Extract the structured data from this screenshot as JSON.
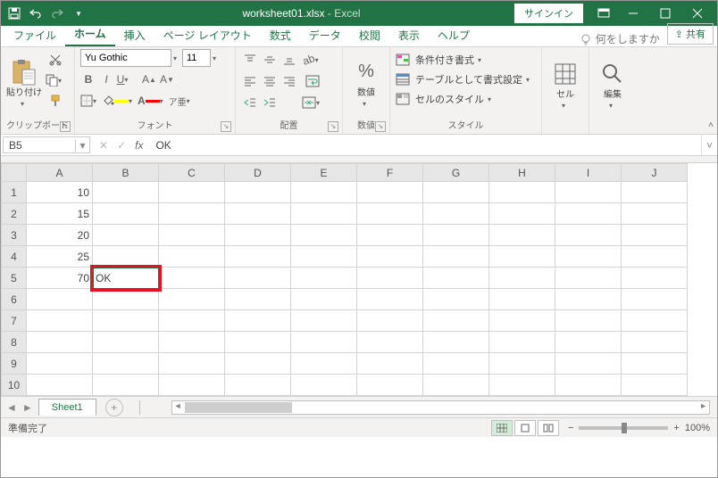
{
  "titlebar": {
    "filename": "worksheet01.xlsx",
    "appname": "Excel",
    "signin": "サインイン"
  },
  "tabs": {
    "file": "ファイル",
    "home": "ホーム",
    "insert": "挿入",
    "pagelayout": "ページ レイアウト",
    "formulas": "数式",
    "data": "データ",
    "review": "校閲",
    "view": "表示",
    "help": "ヘルプ",
    "tellme": "何をしますか",
    "share": "共有"
  },
  "ribbon": {
    "clipboard": {
      "label": "クリップボード",
      "paste": "貼り付け"
    },
    "font": {
      "label": "フォント",
      "name": "Yu Gothic",
      "size": "11"
    },
    "align": {
      "label": "配置",
      "wrap": "ab"
    },
    "number": {
      "label": "数値",
      "fmt": "数値"
    },
    "styles": {
      "label": "スタイル",
      "cond": "条件付き書式",
      "table": "テーブルとして書式設定",
      "cell": "セルのスタイル"
    },
    "cells": {
      "label": "セル"
    },
    "editing": {
      "label": "編集"
    }
  },
  "formula": {
    "cellref": "B5",
    "value": "OK"
  },
  "sheet": {
    "columns": [
      "A",
      "B",
      "C",
      "D",
      "E",
      "F",
      "G",
      "H",
      "I",
      "J"
    ],
    "rows": [
      "1",
      "2",
      "3",
      "4",
      "5",
      "6",
      "7",
      "8",
      "9",
      "10"
    ],
    "cells": {
      "A1": "10",
      "A2": "15",
      "A3": "20",
      "A4": "25",
      "A5": "70",
      "B5": "OK"
    },
    "tabname": "Sheet1"
  },
  "status": {
    "ready": "準備完了",
    "zoom": "100%"
  }
}
